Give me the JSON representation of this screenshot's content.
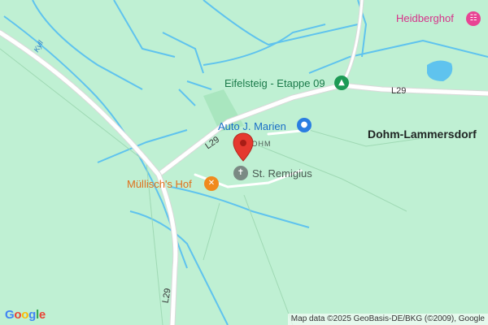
{
  "map": {
    "places": {
      "heidberghof": "Heidberghof",
      "eifelsteig": "Eifelsteig - Etappe 09",
      "auto_marien": "Auto J. Marien",
      "dohm_lammersdorf": "Dohm-Lammersdorf",
      "dohm": "DOHM",
      "st_remigius": "St. Remigius",
      "muellischs_hof": "Müllisch's Hof"
    },
    "roads": {
      "l29_east": "L29",
      "l29_west": "L29",
      "l29_south": "L29"
    },
    "river": "Kyll",
    "attribution": "Map data ©2025 GeoBasis-DE/BKG (©2009), Google",
    "logo": [
      "G",
      "o",
      "o",
      "g",
      "l",
      "e"
    ],
    "icons": {
      "hotel": "bed-icon",
      "hiking": "hiking-icon",
      "shopping": "shopping-bag-icon",
      "church": "cross-icon",
      "restaurant": "fork-knife-icon",
      "pin": "location-pin-icon"
    },
    "colors": {
      "land": "#bff0d3",
      "water": "#5fc3ee",
      "road": "#ffffff",
      "pin": "#e5392f",
      "pink": "#e84494",
      "green": "#1d9a55",
      "blue": "#2a7de1",
      "orange": "#f08a1e",
      "gray": "#7b8a84"
    }
  }
}
